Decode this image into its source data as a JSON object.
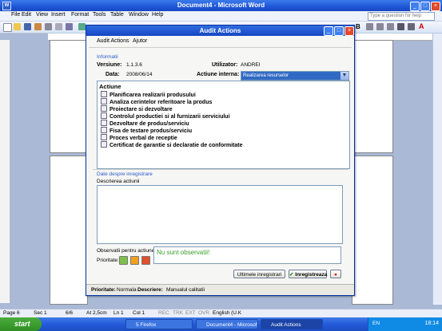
{
  "word": {
    "title": "Document4 - Microsoft Word",
    "menu": [
      "File",
      "Edit",
      "View",
      "Insert",
      "Format",
      "Tools",
      "Table",
      "Window",
      "Help"
    ],
    "help_placeholder": "Type a question for help",
    "status": {
      "page": "Page 6",
      "sec": "Sec 1",
      "pages": "6/6",
      "at": "At 2,5cm",
      "ln": "Ln 1",
      "col": "Col 1",
      "rec": "REC",
      "trk": "TRK",
      "ext": "EXT",
      "ovr": "OVR",
      "lang": "English (U.K"
    }
  },
  "dialog": {
    "title": "Audit Actions",
    "menu": [
      "Audit Actions",
      "Ajutor"
    ],
    "info_section": "Informatii",
    "versiune_label": "Versiune:",
    "versiune_value": "1.1.3.6",
    "utilizator_label": "Utilizator:",
    "utilizator_value": "ANDREI",
    "data_label": "Data:",
    "data_value": "2008/06/14",
    "actiune_label": "Actiune interna:",
    "actiune_value": "Realizarea resurselor",
    "list_header": "Actiune",
    "actions": [
      "Planificarea realizarii produsului",
      "Analiza cerintelor referitoare la produs",
      "Proiectare si dezvoltare",
      "Controlul productiei si al furnizarii serviciului",
      "Dezvoltare de produs/serviciu",
      "Fisa de testare produs/serviciu",
      "Proces verbal de receptie",
      "Certificat de garantie si declaratie de conformitate"
    ],
    "reg_section": "Date despre inregistrare",
    "desc_label": "Descrierea actiunii",
    "obs_label": "Observatii pentru actiune:",
    "obs_value": "Nu sunt observatii!",
    "prio_label": "Prioritate:",
    "btn_last": "Ultimele inregistrari",
    "btn_save": "Inregistreaza",
    "status_prio_label": "Prioritate:",
    "status_prio_value": "Normala",
    "status_desc_label": "Descriere:",
    "status_desc_value": "Manualul calitatii"
  },
  "taskbar": {
    "start": "start",
    "tasks": [
      "5 Firefox",
      "Document4 - Microsof...",
      "Audit Actions"
    ],
    "lang": "EN",
    "clock": "18:14"
  },
  "colors": {
    "accent": "#316ac5",
    "title": "#1f56d8",
    "obs_text": "#3aa02a"
  }
}
